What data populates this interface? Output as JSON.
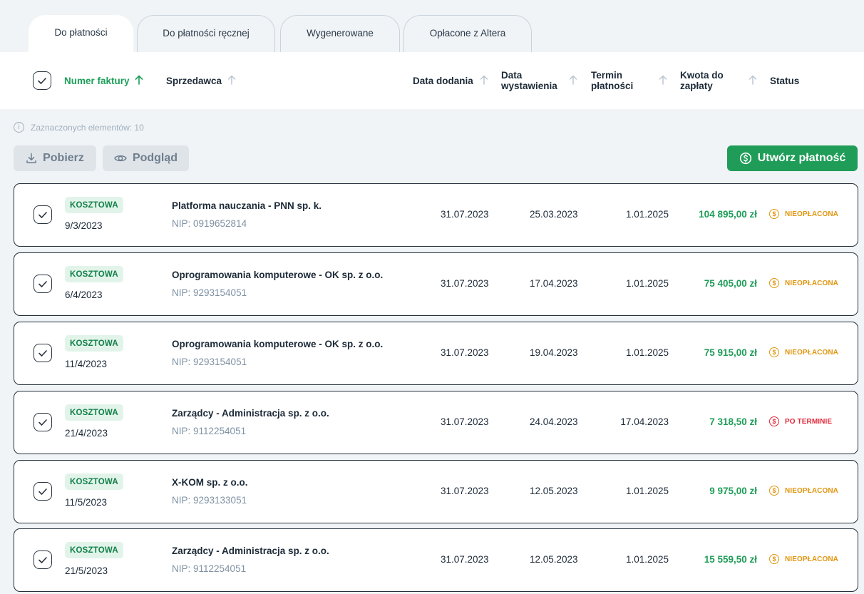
{
  "tabs": [
    {
      "label": "Do płatności",
      "active": true
    },
    {
      "label": "Do płatności ręcznej",
      "active": false
    },
    {
      "label": "Wygenerowane",
      "active": false
    },
    {
      "label": "Opłacone z Altera",
      "active": false
    }
  ],
  "columns": {
    "invoice_number": "Numer faktury",
    "seller": "Sprzedawca",
    "date_added": "Data dodania",
    "issue_date": "Data\nwystawienia",
    "due_date": "Termin\npłatności",
    "amount": "Kwota do\nzapłaty",
    "status": "Status"
  },
  "info_text": "Zaznaczonych elementów: 10",
  "actions": {
    "download": "Pobierz",
    "preview": "Podgląd",
    "create_payment": "Utwórz płatność"
  },
  "colors": {
    "accent_green": "#1f9d58",
    "status_unpaid": "#e0960f",
    "status_overdue": "#e0283a"
  },
  "rows": [
    {
      "type": "KOSZTOWA",
      "invoice": "9/3/2023",
      "seller": "Platforma nauczania - PNN sp. k.",
      "nip": "NIP: 0919652814",
      "date_added": "31.07.2023",
      "issue_date": "25.03.2023",
      "due_date": "1.01.2025",
      "amount": "104 895,00 zł",
      "status": "NIEOPŁACONA",
      "status_kind": "unpaid",
      "checked": true
    },
    {
      "type": "KOSZTOWA",
      "invoice": "6/4/2023",
      "seller": "Oprogramowania komputerowe - OK sp. z o.o.",
      "nip": "NIP: 9293154051",
      "date_added": "31.07.2023",
      "issue_date": "17.04.2023",
      "due_date": "1.01.2025",
      "amount": "75 405,00 zł",
      "status": "NIEOPŁACONA",
      "status_kind": "unpaid",
      "checked": true
    },
    {
      "type": "KOSZTOWA",
      "invoice": "11/4/2023",
      "seller": "Oprogramowania komputerowe - OK sp. z o.o.",
      "nip": "NIP: 9293154051",
      "date_added": "31.07.2023",
      "issue_date": "19.04.2023",
      "due_date": "1.01.2025",
      "amount": "75 915,00 zł",
      "status": "NIEOPŁACONA",
      "status_kind": "unpaid",
      "checked": true
    },
    {
      "type": "KOSZTOWA",
      "invoice": "21/4/2023",
      "seller": "Zarządcy - Administracja sp. z o.o.",
      "nip": "NIP: 9112254051",
      "date_added": "31.07.2023",
      "issue_date": "24.04.2023",
      "due_date": "17.04.2023",
      "amount": "7 318,50 zł",
      "status": "PO TERMINIE",
      "status_kind": "overdue",
      "checked": true
    },
    {
      "type": "KOSZTOWA",
      "invoice": "11/5/2023",
      "seller": "X-KOM sp. z o.o.",
      "nip": "NIP: 9293133051",
      "date_added": "31.07.2023",
      "issue_date": "12.05.2023",
      "due_date": "1.01.2025",
      "amount": "9 975,00 zł",
      "status": "NIEOPŁACONA",
      "status_kind": "unpaid",
      "checked": true
    },
    {
      "type": "KOSZTOWA",
      "invoice": "21/5/2023",
      "seller": "Zarządcy - Administracja sp. z o.o.",
      "nip": "NIP: 9112254051",
      "date_added": "31.07.2023",
      "issue_date": "12.05.2023",
      "due_date": "1.01.2025",
      "amount": "15 559,50 zł",
      "status": "NIEOPŁACONA",
      "status_kind": "unpaid",
      "checked": true
    }
  ]
}
